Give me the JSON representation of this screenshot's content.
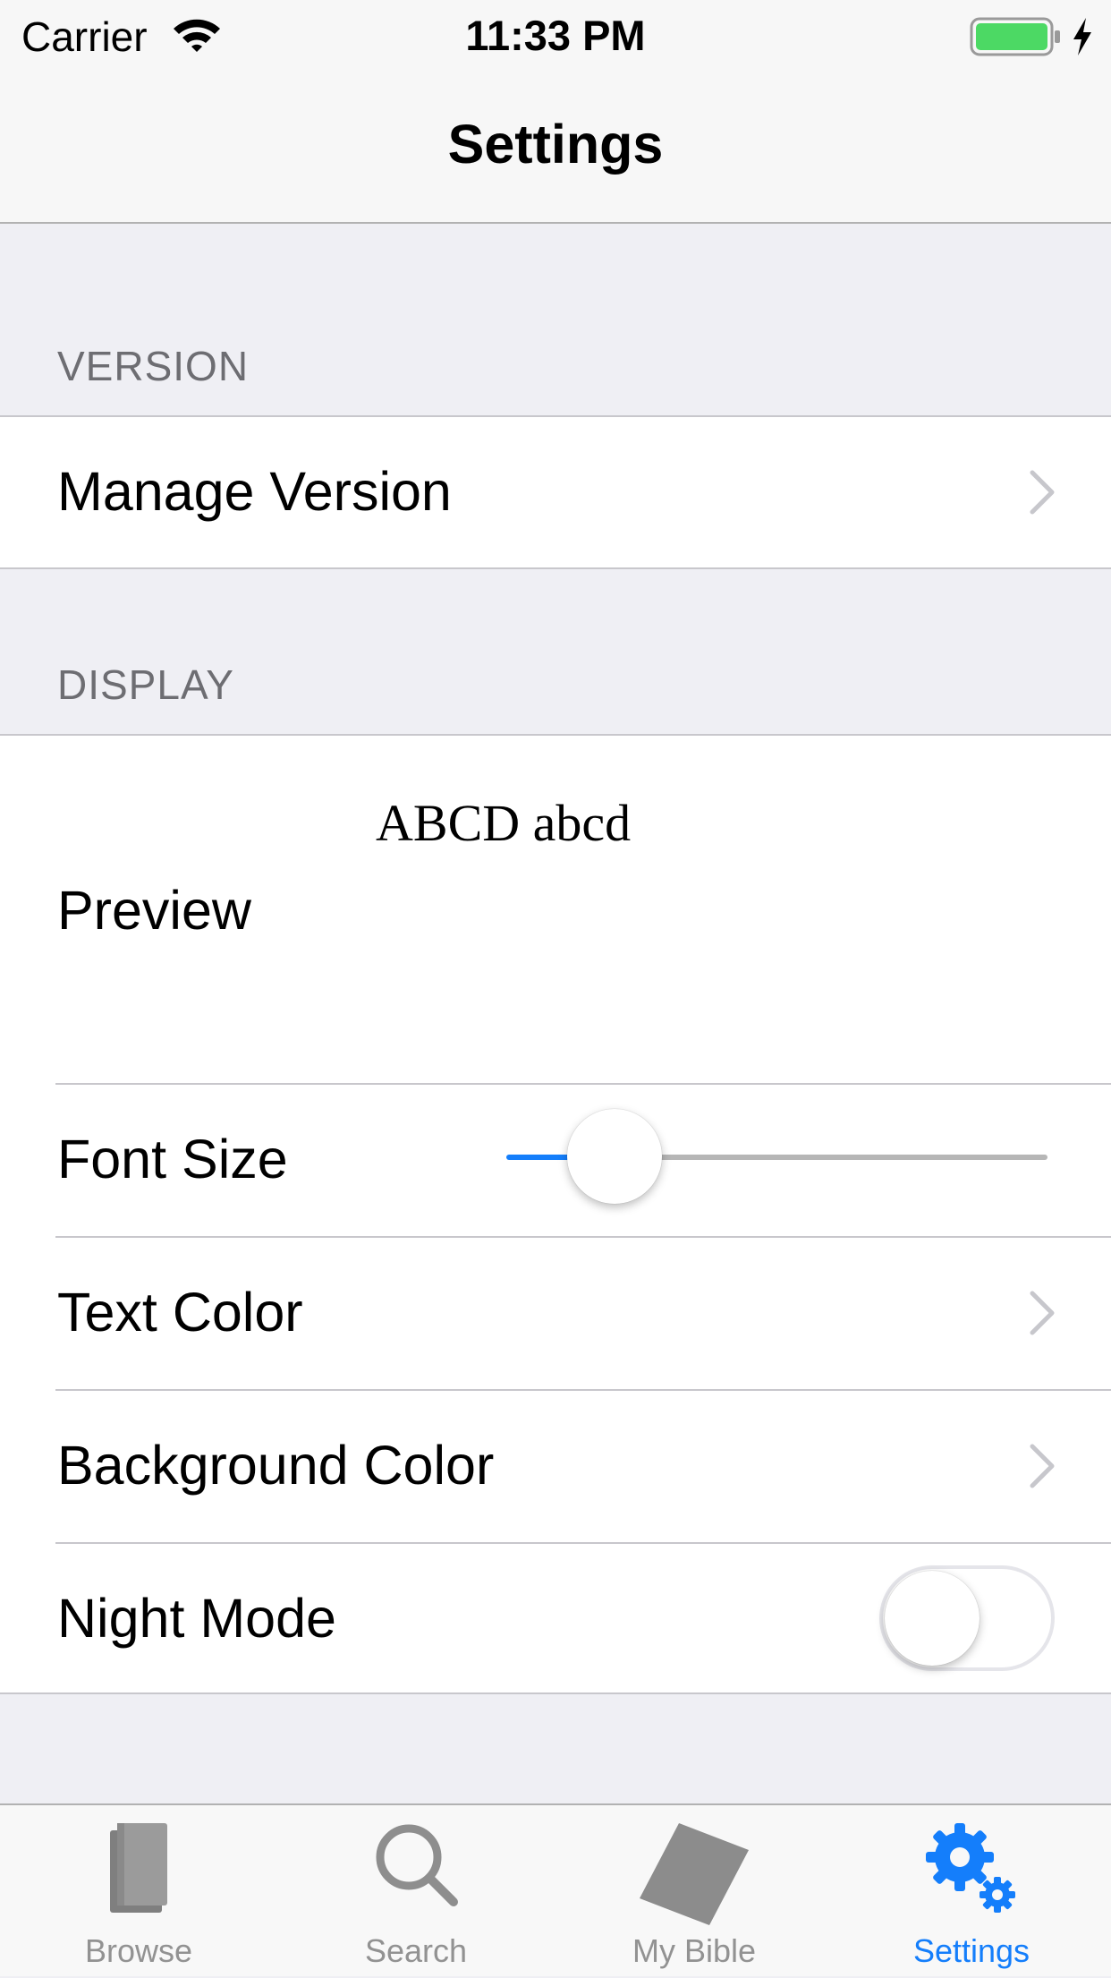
{
  "status_bar": {
    "carrier": "Carrier",
    "time": "11:33 PM",
    "battery_color": "#4cd964"
  },
  "nav": {
    "title": "Settings"
  },
  "sections": {
    "version": {
      "header": "VERSION",
      "manage_label": "Manage Version"
    },
    "display": {
      "header": "DISPLAY",
      "preview_label": "Preview",
      "preview_sample": "ABCD abcd",
      "font_size_label": "Font Size",
      "font_size_level": 0.2,
      "text_color_label": "Text Color",
      "background_color_label": "Background Color",
      "night_mode_label": "Night Mode",
      "night_mode_on": false
    }
  },
  "tabbar": {
    "tabs": [
      {
        "label": "Browse",
        "icon": "book-icon",
        "active": false
      },
      {
        "label": "Search",
        "icon": "search-icon",
        "active": false
      },
      {
        "label": "My Bible",
        "icon": "tablet-icon",
        "active": false
      },
      {
        "label": "Settings",
        "icon": "gear-icon",
        "active": true
      }
    ],
    "active_color": "#147efb",
    "inactive_color": "#929292"
  }
}
